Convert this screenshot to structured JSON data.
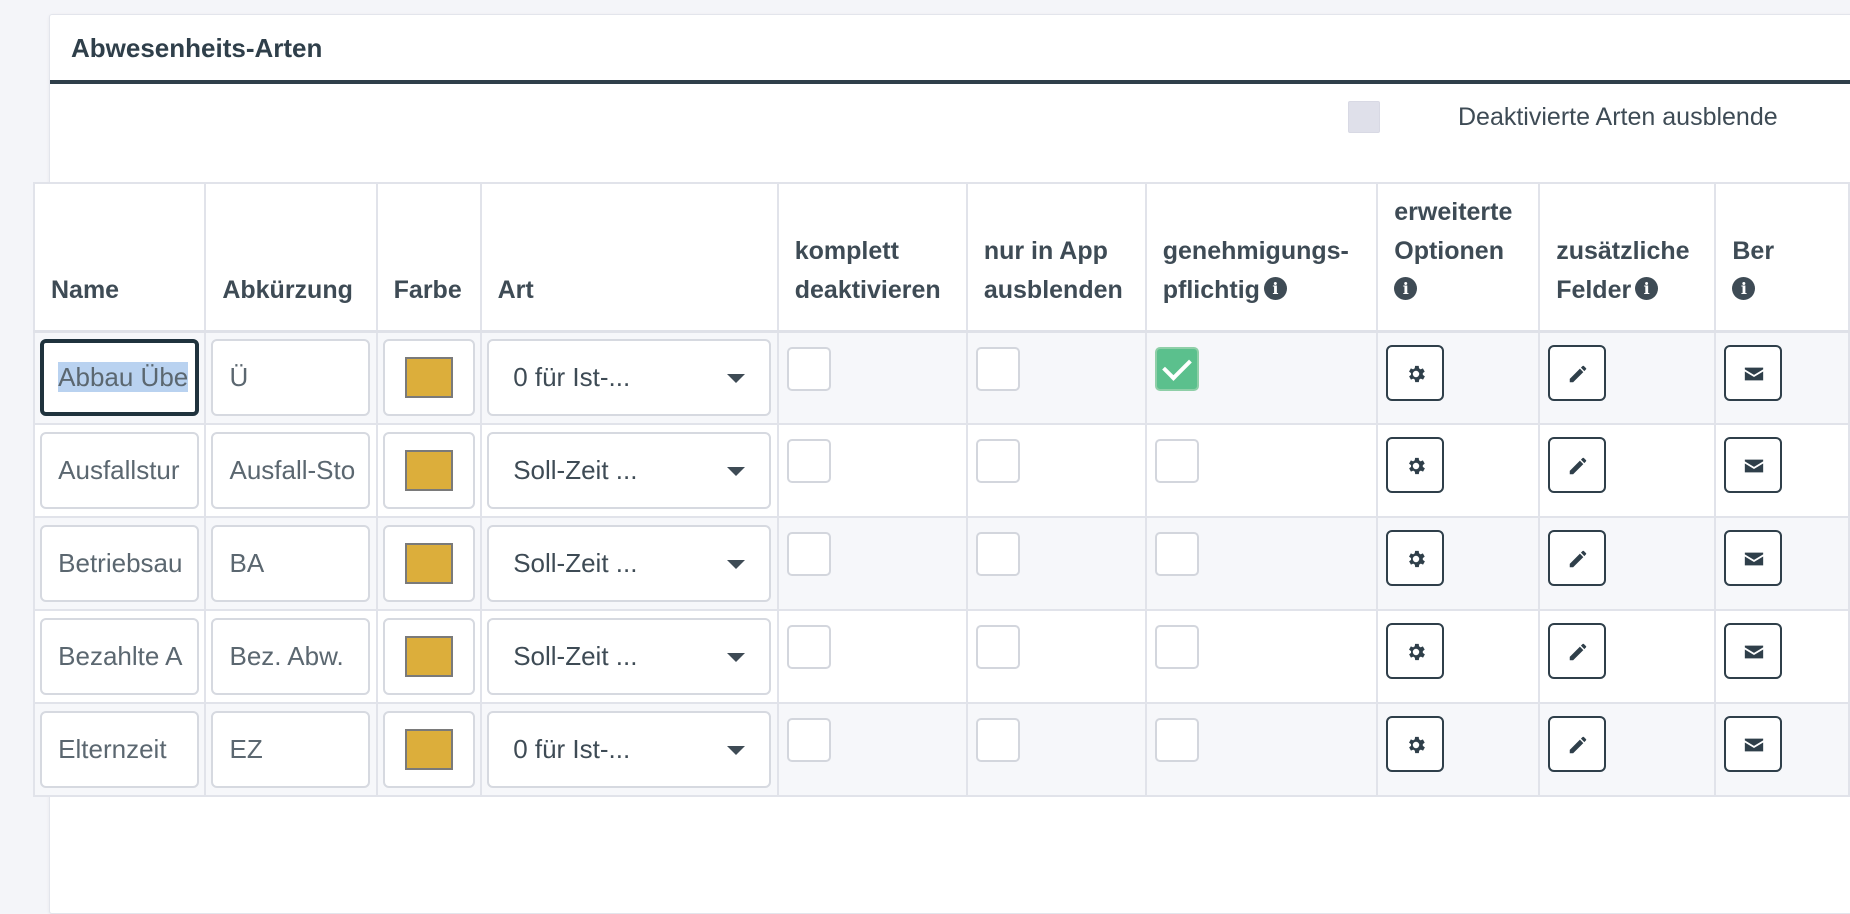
{
  "panel": {
    "title": "Abwesenheits-Arten",
    "filter_label": "Deaktivierte Arten ausblende"
  },
  "table": {
    "headers": {
      "name": "Name",
      "abbr": "Abkürzung",
      "color": "Farbe",
      "type": "Art",
      "deactivate_l1": "komplett",
      "deactivate_l2": "deaktivieren",
      "hide_app_l1": "nur in App",
      "hide_app_l2": "ausblenden",
      "approval_l1": "genehmigungs-",
      "approval_l2": "pflichtig",
      "ext_options_l1": "erweiterte",
      "ext_options_l2": "Optionen",
      "extra_fields_l1": "zusätzliche",
      "extra_fields_l2": "Felder",
      "notify_l1": "Ber"
    },
    "rows": [
      {
        "name": "Abbau Übe",
        "abbr": "Ü",
        "type": "0 für Ist-...",
        "deactivated": false,
        "hide_app": false,
        "approval": true
      },
      {
        "name": "Ausfallstur",
        "abbr": "Ausfall-Sto",
        "type": "Soll-Zeit ...",
        "deactivated": false,
        "hide_app": false,
        "approval": false
      },
      {
        "name": "Betriebsau",
        "abbr": "BA",
        "type": "Soll-Zeit ...",
        "deactivated": false,
        "hide_app": false,
        "approval": false
      },
      {
        "name": "Bezahlte A",
        "abbr": "Bez. Abw.",
        "type": "Soll-Zeit ...",
        "deactivated": false,
        "hide_app": false,
        "approval": false
      },
      {
        "name": "Elternzeit",
        "abbr": "EZ",
        "type": "0 für Ist-...",
        "deactivated": false,
        "hide_app": false,
        "approval": false
      }
    ]
  },
  "colors": {
    "swatch": "#dcae3b",
    "header_border": "#2f3f4a",
    "check_green": "#5bc08d"
  },
  "icons": {
    "info": "info-circle-icon",
    "settings": "gear-icon",
    "edit": "pencil-icon",
    "mail": "envelope-icon"
  }
}
